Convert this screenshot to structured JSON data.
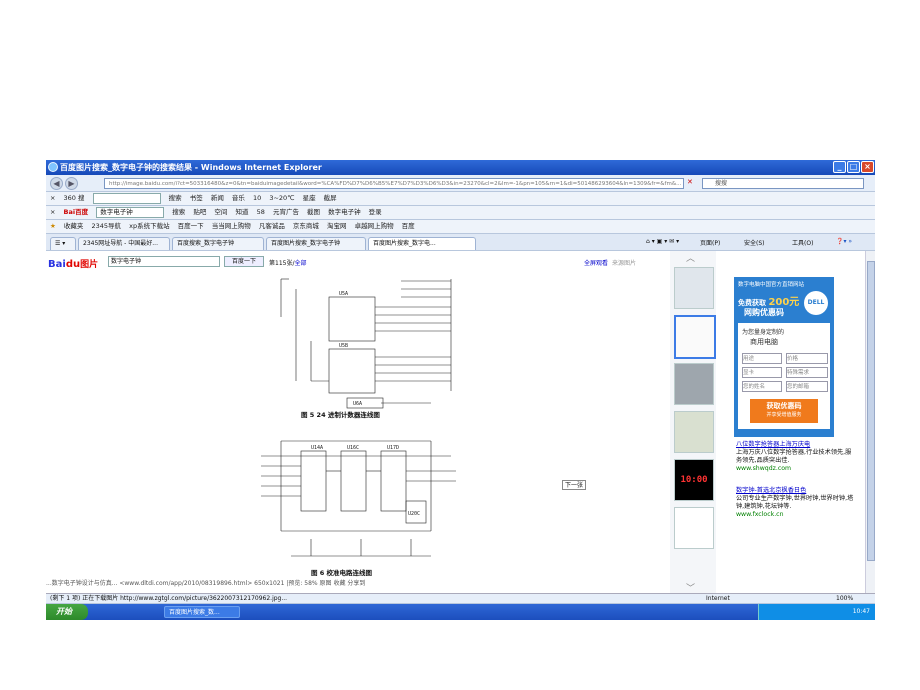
{
  "window": {
    "title": "百度图片搜索_数字电子钟的搜索结果 - Windows Internet Explorer",
    "address": "http://image.baidu.com/i?ct=503316480&z=0&tn=baiduimagedetail&word=%CA%FD%D7%D6%B5%E7%D7%D3%D6%D3&in=23270&cl=2&lm=-1&pn=105&rn=1&di=501486293604&ln=1309&fr=&fm&...",
    "search_placeholder": "搜搜",
    "toolbar1": [
      "360 搜",
      "搜索",
      "书签",
      "新闻",
      "音乐",
      "10",
      "3~20℃",
      "星座",
      "截屏"
    ],
    "toolbar2": [
      "Bai百度",
      "数字电子钟",
      "搜索",
      "贴吧",
      "空间",
      "知道",
      "58",
      "元宵广告",
      "截图",
      "数字电子钟",
      "登录"
    ],
    "favorites": [
      "收藏夹",
      "2345导航",
      "xp系统下载站",
      "百度一下",
      "当当网上购物",
      "凡客诚品",
      "京东商城",
      "淘宝网",
      "卓越网上购物",
      "百度"
    ],
    "tabs": [
      "2345网址导航 - 中国最好...",
      "百度搜索_数字电子钟",
      "百度图片搜索_数字电子钟",
      "百度图片搜索_数字电..."
    ],
    "commandbar": [
      "页面(P)",
      "安全(S)",
      "工具(O)"
    ]
  },
  "page": {
    "logo_bai": "Bai",
    "logo_du": "du",
    "logo_img": "图片",
    "query": "数字电子钟",
    "search_button": "百度一下",
    "count_prefix": "第115张/",
    "count_link": "全部",
    "full_view": "全屏观看",
    "source_view": "来源图片",
    "figure5_caption": "图 5   24 进制计数器连线图",
    "figure6_caption": "图 6   校准电路连线图",
    "next_button": "下一张",
    "footer": "...数字电子钟设计与仿真...  <www.dltdi.com/app/2010/08319896.html>        650x1021 |预览: 58%    原图   收藏   分享到",
    "ad": {
      "top": "数字电脑中国官方直销网站",
      "offer_prefix": "免费获取",
      "offer_amount": "200元",
      "offer_suffix": "网购优惠码",
      "brand": "DELL",
      "subtitle": "为您量身定制的",
      "subtitle2": "商用电脑",
      "fields": [
        "用途",
        "价格",
        "显卡",
        "特殊需求",
        "您的姓名",
        "您的邮箱"
      ],
      "cta": "获取优惠码",
      "cta_sub": "并享受增值服务"
    },
    "links": [
      {
        "title": "八位数字抢答器上海万庆电",
        "desc": "上海万庆八位数字抢答器,行业技术领先,服务领先,品质突出佳.",
        "url": "www.shwqdz.com"
      },
      {
        "title": "数字钟-首选北京枫香日色",
        "desc": "公司专业生产数字钟,世界时钟,世界时钟,塔钟,建筑钟,花坛钟等.",
        "url": "www.fxclock.cn"
      }
    ],
    "thumb_clock": "10:00"
  },
  "status": {
    "text": "(剩下 1 项) 正在下载图片 http://www.zgtgl.com/picture/3622007312170962.jpg...",
    "zone": "Internet",
    "zoom": "100%"
  },
  "taskbar": {
    "start": "开始",
    "item": "百度图片搜索_数...",
    "clock": "10:47"
  }
}
